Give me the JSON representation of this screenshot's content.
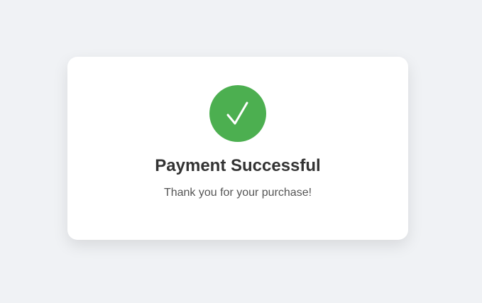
{
  "dialog": {
    "icon": "check-icon",
    "title": "Payment Successful",
    "message": "Thank you for your purchase!"
  },
  "colors": {
    "background": "#f0f2f5",
    "card": "#ffffff",
    "success": "#4caf50",
    "title": "#333333",
    "message": "#555555"
  }
}
